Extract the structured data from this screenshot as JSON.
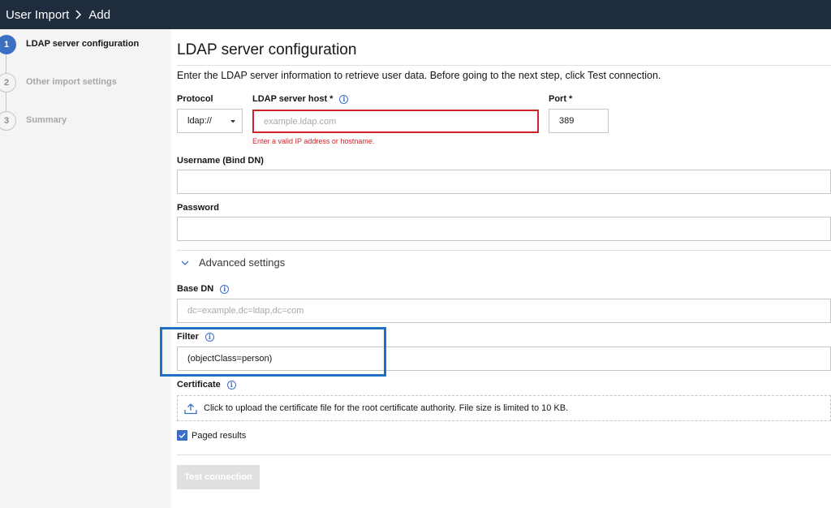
{
  "breadcrumb": {
    "parent": "User Import",
    "current": "Add"
  },
  "steps": [
    {
      "number": "1",
      "label": "LDAP server configuration",
      "state": "active"
    },
    {
      "number": "2",
      "label": "Other import settings",
      "state": "inactive"
    },
    {
      "number": "3",
      "label": "Summary",
      "state": "inactive"
    }
  ],
  "page": {
    "title": "LDAP server configuration",
    "intro": "Enter the LDAP server information to retrieve user data. Before going to the next step, click Test connection."
  },
  "form": {
    "protocol": {
      "label": "Protocol",
      "value": "ldap://"
    },
    "host": {
      "label": "LDAP server host *",
      "placeholder": "example.ldap.com",
      "value": "",
      "error": "Enter a valid IP address or hostname."
    },
    "port": {
      "label": "Port *",
      "value": "389"
    },
    "username": {
      "label": "Username (Bind DN)",
      "value": ""
    },
    "password": {
      "label": "Password",
      "value": ""
    },
    "advanced": {
      "label": "Advanced settings",
      "expanded": true
    },
    "base_dn": {
      "label": "Base DN",
      "placeholder": "dc=example,dc=ldap,dc=com",
      "value": ""
    },
    "filter": {
      "label": "Filter",
      "value": "(objectClass=person)"
    },
    "certificate": {
      "label": "Certificate",
      "upload_text": "Click to upload the certificate file for the root certificate authority. File size is limited to 10 KB."
    },
    "paged_results": {
      "label": "Paged results",
      "checked": true
    },
    "test_button": "Test connection"
  },
  "colors": {
    "header_bg": "#1e2c3d",
    "accent": "#3b6fc4",
    "error": "#d2232a",
    "highlight": "#1f6fc5"
  }
}
